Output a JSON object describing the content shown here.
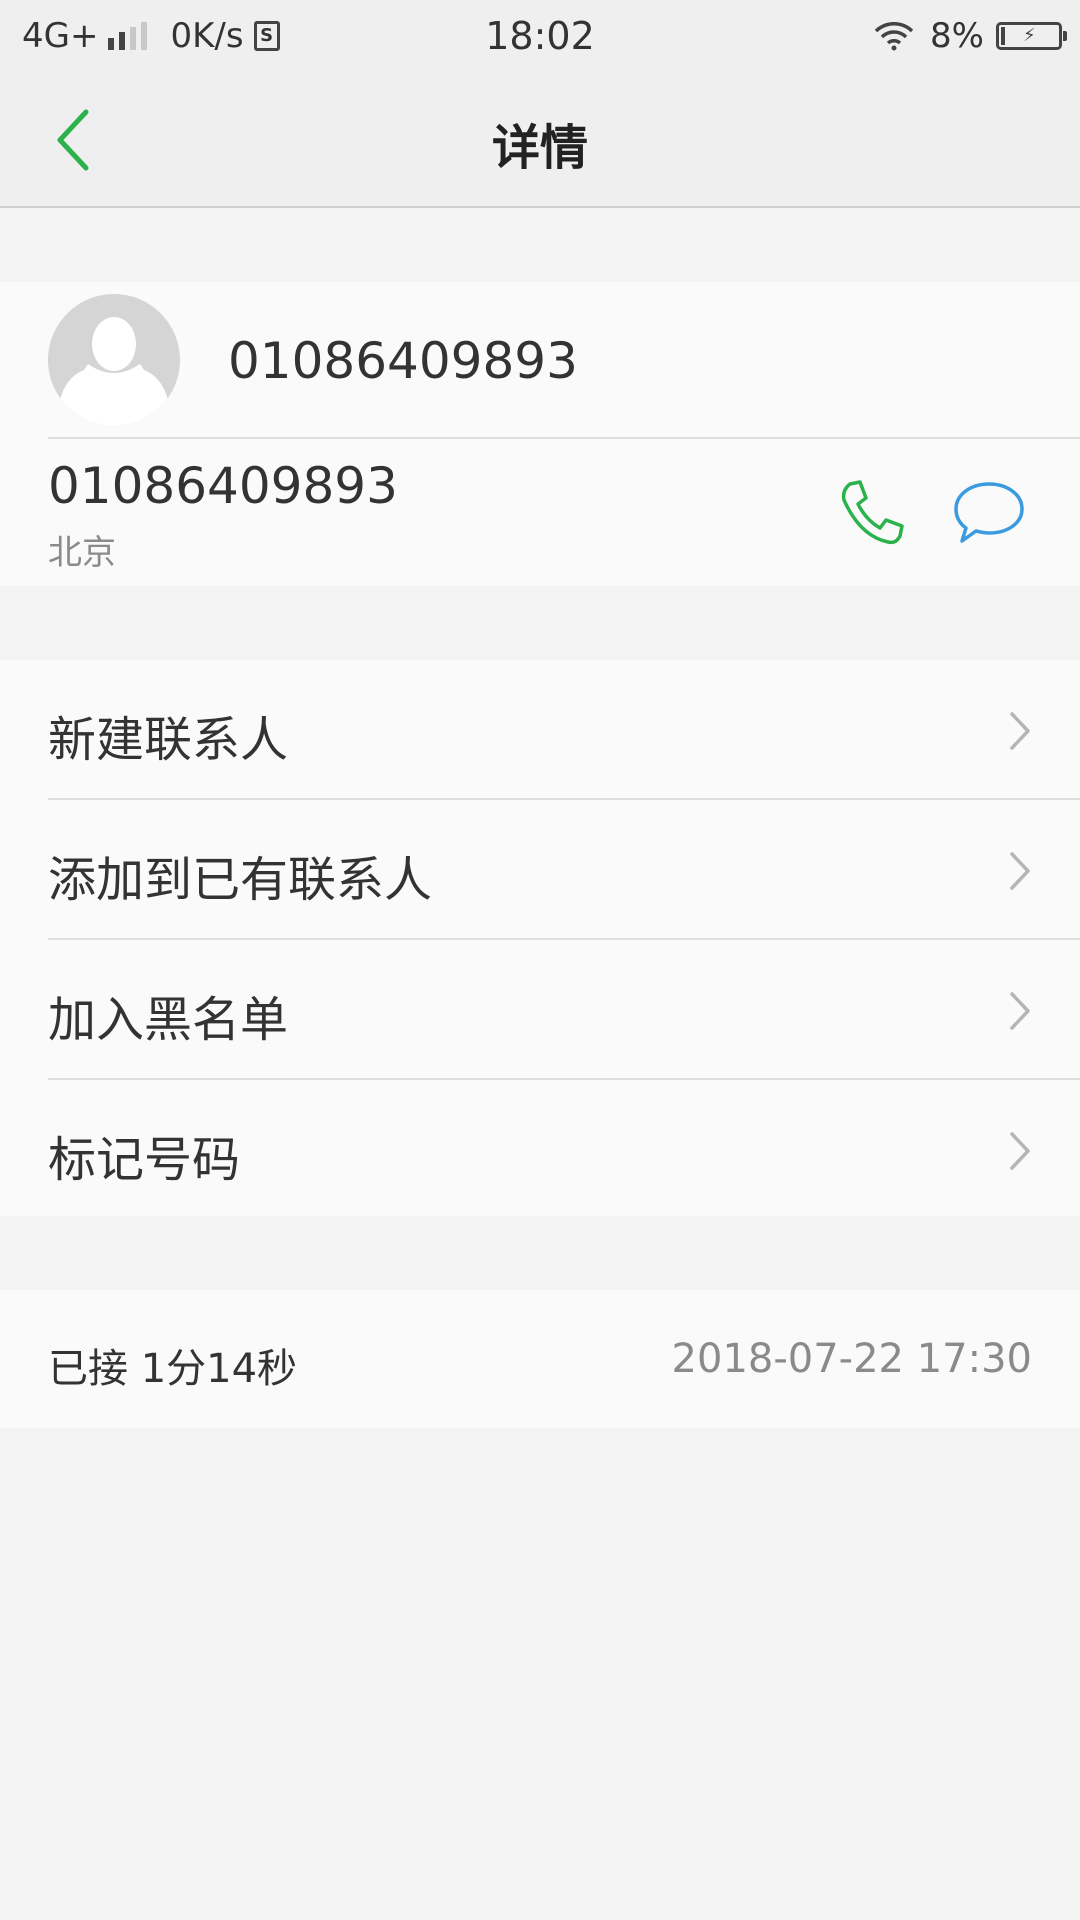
{
  "status_bar": {
    "network": "4G+",
    "speed": "0K/s",
    "sim_label": "S",
    "time": "18:02",
    "battery": "8%",
    "battery_level": 0.08
  },
  "header": {
    "title": "详情",
    "back_icon": "chevron-left-icon"
  },
  "contact": {
    "header_number": "01086409893",
    "phone_number": "01086409893",
    "location": "北京",
    "avatar_icon": "person-silhouette-icon",
    "call_icon": "phone-icon",
    "message_icon": "chat-bubble-icon"
  },
  "actions": [
    {
      "label": "新建联系人"
    },
    {
      "label": "添加到已有联系人"
    },
    {
      "label": "加入黑名单"
    },
    {
      "label": "标记号码"
    }
  ],
  "call_log": {
    "status": "已接 1分14秒",
    "datetime": "2018-07-22 17:30"
  },
  "colors": {
    "accent_green": "#2bb24c",
    "message_blue": "#3a9be0",
    "background": "#f3f3f3",
    "card": "#fafafa"
  }
}
